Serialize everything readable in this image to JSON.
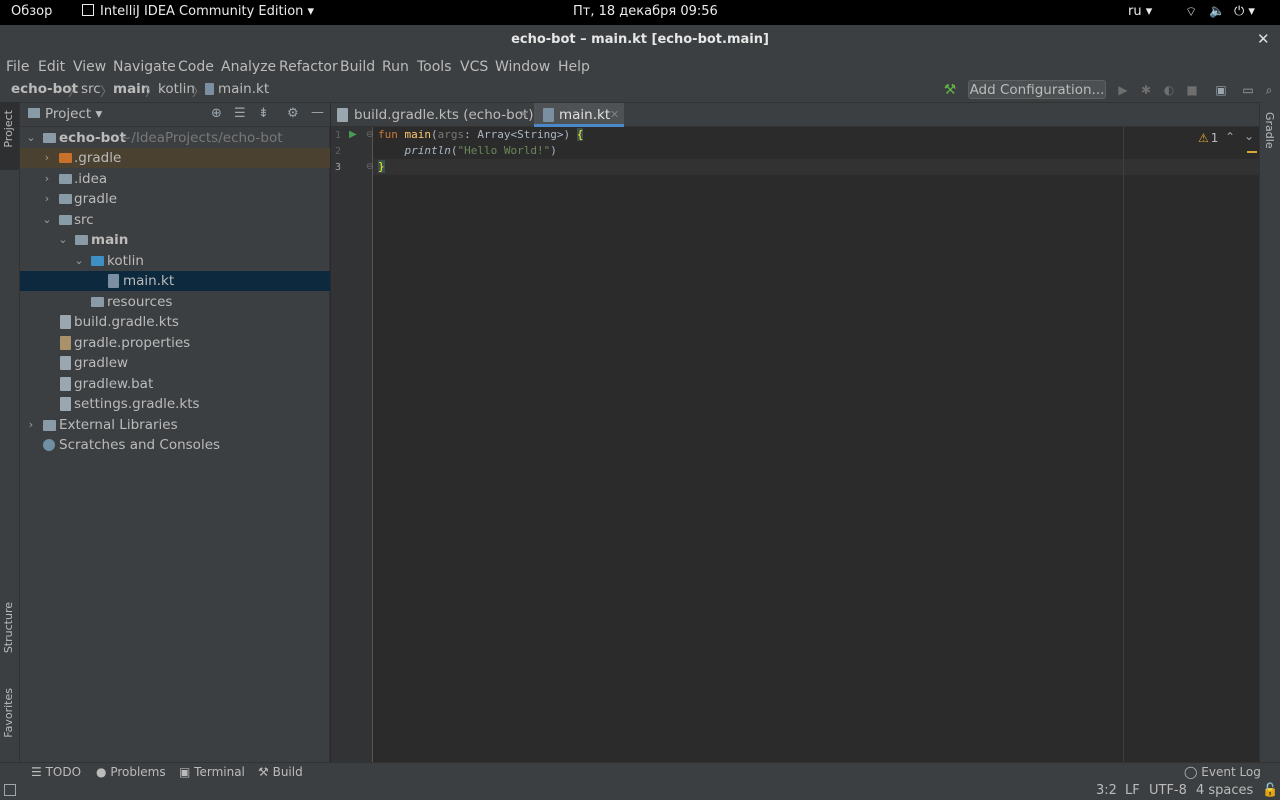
{
  "topbar": {
    "overview": "Обзор",
    "app_name": "IntelliJ IDEA Community Edition",
    "datetime": "Пт, 18 декабря  09:56",
    "lang": "ru"
  },
  "window": {
    "title": "echo-bot – main.kt [echo-bot.main]"
  },
  "menu": {
    "file": "File",
    "edit": "Edit",
    "view": "View",
    "navigate": "Navigate",
    "code": "Code",
    "analyze": "Analyze",
    "refactor": "Refactor",
    "build": "Build",
    "run": "Run",
    "tools": "Tools",
    "vcs": "VCS",
    "window": "Window",
    "help": "Help"
  },
  "breadcrumb": [
    "echo-bot",
    "src",
    "main",
    "kotlin",
    "main.kt"
  ],
  "toolbar": {
    "add_configuration": "Add Configuration..."
  },
  "left_strip": {
    "project": "Project",
    "structure": "Structure",
    "favorites": "Favorites"
  },
  "right_strip": {
    "gradle": "Gradle"
  },
  "project_panel": {
    "title": "Project",
    "root_name": "echo-bot",
    "root_path": "~/IdeaProjects/echo-bot",
    "items": {
      "gradle_dot": ".gradle",
      "idea": ".idea",
      "gradle": "gradle",
      "src": "src",
      "main": "main",
      "kotlin": "kotlin",
      "main_kt": "main.kt",
      "resources": "resources",
      "build_gradle_kts": "build.gradle.kts",
      "gradle_properties": "gradle.properties",
      "gradlew": "gradlew",
      "gradlew_bat": "gradlew.bat",
      "settings_gradle_kts": "settings.gradle.kts",
      "external_libraries": "External Libraries",
      "scratches": "Scratches and Consoles"
    }
  },
  "tabs": [
    {
      "label": "build.gradle.kts (echo-bot)"
    },
    {
      "label": "main.kt"
    }
  ],
  "editor": {
    "line_numbers": [
      "1",
      "2",
      "3"
    ],
    "line1": {
      "kw": "fun",
      "fn": "main",
      "open": "(",
      "param": "args",
      "type": ": Array<String>) ",
      "brace": "{"
    },
    "line2": {
      "call": "println",
      "open": "(",
      "str": "\"Hello World!\"",
      "close": ")"
    },
    "line3": {
      "brace": "}"
    },
    "warnings": "1"
  },
  "bottom_tools": {
    "todo": "TODO",
    "problems": "Problems",
    "terminal": "Terminal",
    "build": "Build",
    "event_log": "Event Log"
  },
  "status": {
    "position": "3:2",
    "line_sep": "LF",
    "encoding": "UTF-8",
    "indent": "4 spaces"
  }
}
